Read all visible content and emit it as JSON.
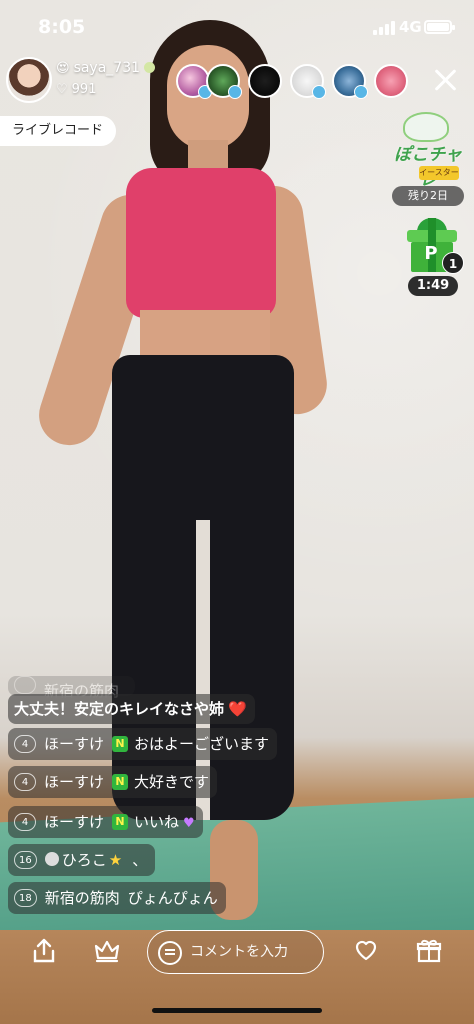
{
  "status_bar": {
    "time": "8:05",
    "network": "4G"
  },
  "host": {
    "name": "saya_731",
    "name_emoji": "😍",
    "likes": "991"
  },
  "header": {
    "live_record_label": "ライブレコード"
  },
  "viewers": [
    {
      "name": "viewer-1"
    },
    {
      "name": "viewer-2"
    },
    {
      "name": "viewer-3"
    },
    {
      "name": "viewer-4"
    },
    {
      "name": "viewer-5"
    },
    {
      "name": "viewer-6"
    }
  ],
  "event": {
    "title": "ぽこチャレ",
    "subtitle": "イースター",
    "remaining": "残り2日"
  },
  "gift": {
    "label": "P",
    "count": "1",
    "timer": "1:49"
  },
  "comments": [
    {
      "level": "",
      "user": "新宿の筋肉",
      "text": ""
    },
    {
      "level": "",
      "user": "",
      "text": "大丈夫！安定のキレイなさや姉"
    },
    {
      "level": "4",
      "user": "ほーすけ",
      "badge": "N",
      "text": "おはよーございます"
    },
    {
      "level": "4",
      "user": "ほーすけ",
      "badge": "N",
      "text": "大好きです"
    },
    {
      "level": "4",
      "user": "ほーすけ",
      "badge": "N",
      "text": "いいね"
    },
    {
      "level": "16",
      "user": "ひろこ",
      "text": "、"
    },
    {
      "level": "18",
      "user": "新宿の筋肉",
      "text": "ぴょんぴょん"
    }
  ],
  "bottom_bar": {
    "comment_placeholder": "コメントを入力"
  },
  "colors": {
    "accent_green": "#3fb23a",
    "live_pink": "#e0406a"
  }
}
